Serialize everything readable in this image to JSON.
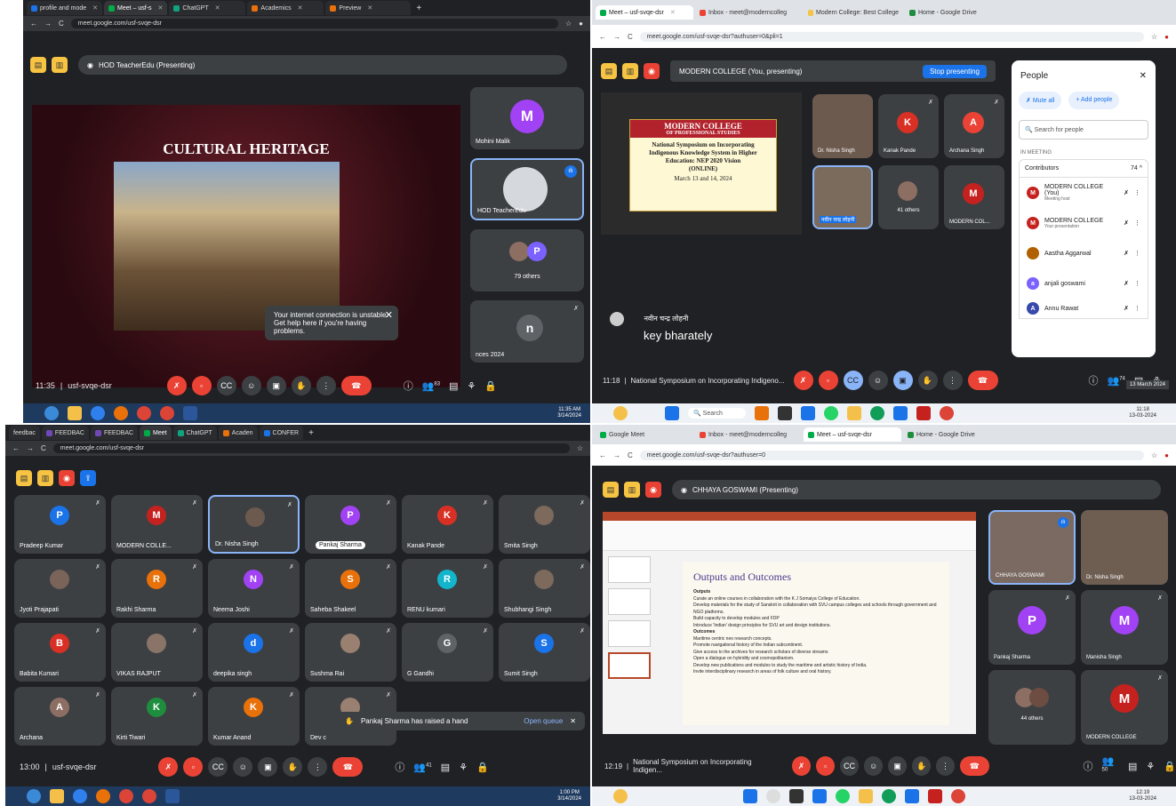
{
  "q1": {
    "tabs": [
      "profile and mode",
      "Meet – usf-s",
      "ChatGPT",
      "Academics",
      "Preview"
    ],
    "url": "meet.google.com/usf-svqe-dsr",
    "presenter": "HOD TeacherEdu (Presenting)",
    "slide_title": "CULTURAL HERITAGE",
    "tiles": [
      {
        "name": "Mohini Malik",
        "letter": "M",
        "color": "#a142f4"
      },
      {
        "name": "HOD TeacherEdu"
      },
      {
        "name": "79 others",
        "letter": "P",
        "color": "#7b61ff"
      },
      {
        "name": "nces 2024",
        "letter": "n",
        "color": "#5f6368"
      }
    ],
    "toast": "Your internet connection is unstable. Get help here if you're having problems.",
    "time": "11:35",
    "code": "usf-svqe-dsr",
    "badge": "83",
    "clock": "11:35 AM",
    "date": "3/14/2024"
  },
  "q2": {
    "tabs": [
      "Meet – usf-svqe-dsr",
      "Inbox - meet@moderncolleg",
      "Modern College: Best College",
      "Home - Google Drive"
    ],
    "url": "meet.google.com/usf-svqe-dsr?authuser=0&pli=1",
    "presenting": "MODERN COLLEGE (You, presenting)",
    "stop": "Stop presenting",
    "slide": {
      "h1": "MODERN COLLEGE",
      "h2": "OF PROFESSIONAL STUDIES",
      "l1": "National Symposium on Incorporating",
      "l2": "Indigenous Knowledge System in Higher",
      "l3": "Education: NEP 2020 Vision",
      "l4": "(ONLINE)",
      "l5": "March 13 and 14, 2024"
    },
    "tiles": [
      {
        "name": "Dr. Nisha Singh"
      },
      {
        "name": "Kanak Pande",
        "letter": "K",
        "color": "#d93025"
      },
      {
        "name": "Archana Singh",
        "letter": "A",
        "color": "#ea4335"
      },
      {
        "name": "नवीन चन्द्र लोहनी"
      },
      {
        "name": "41 others"
      },
      {
        "name": "MODERN COL...",
        "letter": "M",
        "color": "#c5221f"
      }
    ],
    "caption_name": "नवीन चन्द्र लोहनी",
    "caption_text": "key bharately",
    "people": {
      "title": "People",
      "mute": "Mute all",
      "add": "Add people",
      "search": "Search for people",
      "in_meeting": "IN MEETING",
      "contributors": "Contributors",
      "count": "74",
      "rows": [
        {
          "name": "MODERN COLLEGE (You)",
          "sub": "Meeting host",
          "letter": "M",
          "color": "#c5221f"
        },
        {
          "name": "MODERN COLLEGE",
          "sub": "Your presentation",
          "letter": "M",
          "color": "#c5221f"
        },
        {
          "name": "Aastha Aggarwal",
          "sub": "",
          "letter": "",
          "color": "#b06000"
        },
        {
          "name": "anjali goswami",
          "sub": "",
          "letter": "a",
          "color": "#7b61ff"
        },
        {
          "name": "Annu Rawat",
          "sub": "",
          "letter": "A",
          "color": "#3949ab"
        }
      ]
    },
    "time": "11:18",
    "meeting_title": "National Symposium on Incorporating Indigeno...",
    "badge": "74",
    "clock": "11:18",
    "date": "13-03-2024",
    "search": "Search",
    "date_tip": "13 March 2024"
  },
  "q3": {
    "tabs": [
      "feedbac",
      "FEEDBAC",
      "FEEDBAC",
      "Meet",
      "ChatGPT",
      "Acaden",
      "CONFER"
    ],
    "url": "meet.google.com/usf-svqe-dsr",
    "tiles": [
      {
        "name": "Pradeep Kumar",
        "letter": "P",
        "color": "#1a73e8"
      },
      {
        "name": "MODERN COLLE...",
        "letter": "M",
        "color": "#c5221f"
      },
      {
        "name": "Dr. Nisha Singh"
      },
      {
        "name": "Pankaj Sharma",
        "letter": "P",
        "color": "#a142f4"
      },
      {
        "name": "Kanak Pande",
        "letter": "K",
        "color": "#d93025"
      },
      {
        "name": "Smita Singh"
      },
      {
        "name": "Jyoti Prajapati"
      },
      {
        "name": "Rakhi Sharma",
        "letter": "R",
        "color": "#e8710a"
      },
      {
        "name": "Neema Joshi",
        "letter": "N",
        "color": "#a142f4"
      },
      {
        "name": "Saheba Shakeel",
        "letter": "S",
        "color": "#e8710a"
      },
      {
        "name": "RENU kumari",
        "letter": "R",
        "color": "#12b5cb"
      },
      {
        "name": "Shubhangi Singh"
      },
      {
        "name": "Babita Kumari",
        "letter": "B",
        "color": "#d93025"
      },
      {
        "name": "VIKAS RAJPUT"
      },
      {
        "name": "deepika singh",
        "letter": "d",
        "color": "#1a73e8"
      },
      {
        "name": "Sushma Rai"
      },
      {
        "name": "G Gandhi",
        "letter": "G",
        "color": "#5f6368"
      },
      {
        "name": "Sumit Singh",
        "letter": "S",
        "color": "#1a73e8"
      },
      {
        "name": "Archana",
        "letter": "A",
        "color": "#8d6e63"
      },
      {
        "name": "Kirti Tiwari",
        "letter": "K",
        "color": "#1e8e3e"
      },
      {
        "name": "Kumar Anand",
        "letter": "K",
        "color": "#e8710a"
      },
      {
        "name": "Dev c"
      }
    ],
    "toast": "Pankaj Sharma has raised a hand",
    "queue": "Open queue",
    "time": "13:00",
    "code": "usf-svqe-dsr",
    "badge": "41",
    "clock": "1:00 PM",
    "date": "3/14/2024"
  },
  "q4": {
    "tabs": [
      "Google Meet",
      "Inbox - meet@moderncolleg",
      "Meet – usf-svqe-dsr",
      "Home - Google Drive"
    ],
    "url": "meet.google.com/usf-svqe-dsr?authuser=0",
    "presenter": "CHHAYA GOSWAMI (Presenting)",
    "slide_title": "Outputs and Outcomes",
    "bullets": [
      "Outputs",
      "Curate an online courses in collaboration with the K J Somaiya College of Education.",
      "Develop materials for the study of Sanskrit in collaboration with SVU campus colleges and schools through government and NGO platforms.",
      "Build capacity to develop modules and FDP",
      "Introduce 'Indian' design principles for SVU art and design institutions.",
      "Outcomes",
      "Maritime centric neo research concepts.",
      "Promote navigational history of the Indian subcontinent.",
      "Give access to the archives for research scholars of diverse streams",
      "Open a dialogue on hybridity and cosmopolitanism.",
      "Develop new publications and modules to study the maritime and artistic history of India.",
      "Invite interdisciplinary research in areas of folk culture and oral history."
    ],
    "tiles": [
      {
        "name": "CHHAYA GOSWAMI"
      },
      {
        "name": "Dr. Nisha Singh"
      },
      {
        "name": "Pankaj Sharma",
        "letter": "P",
        "color": "#a142f4"
      },
      {
        "name": "Manisha Singh",
        "letter": "M",
        "color": "#a142f4"
      },
      {
        "name": "44 others"
      },
      {
        "name": "MODERN COLLEGE",
        "letter": "M",
        "color": "#c5221f"
      }
    ],
    "time": "12:19",
    "meeting_title": "National Symposium on Incorporating Indigen...",
    "badge": "50",
    "clock": "12:19",
    "date": "13-03-2024"
  }
}
